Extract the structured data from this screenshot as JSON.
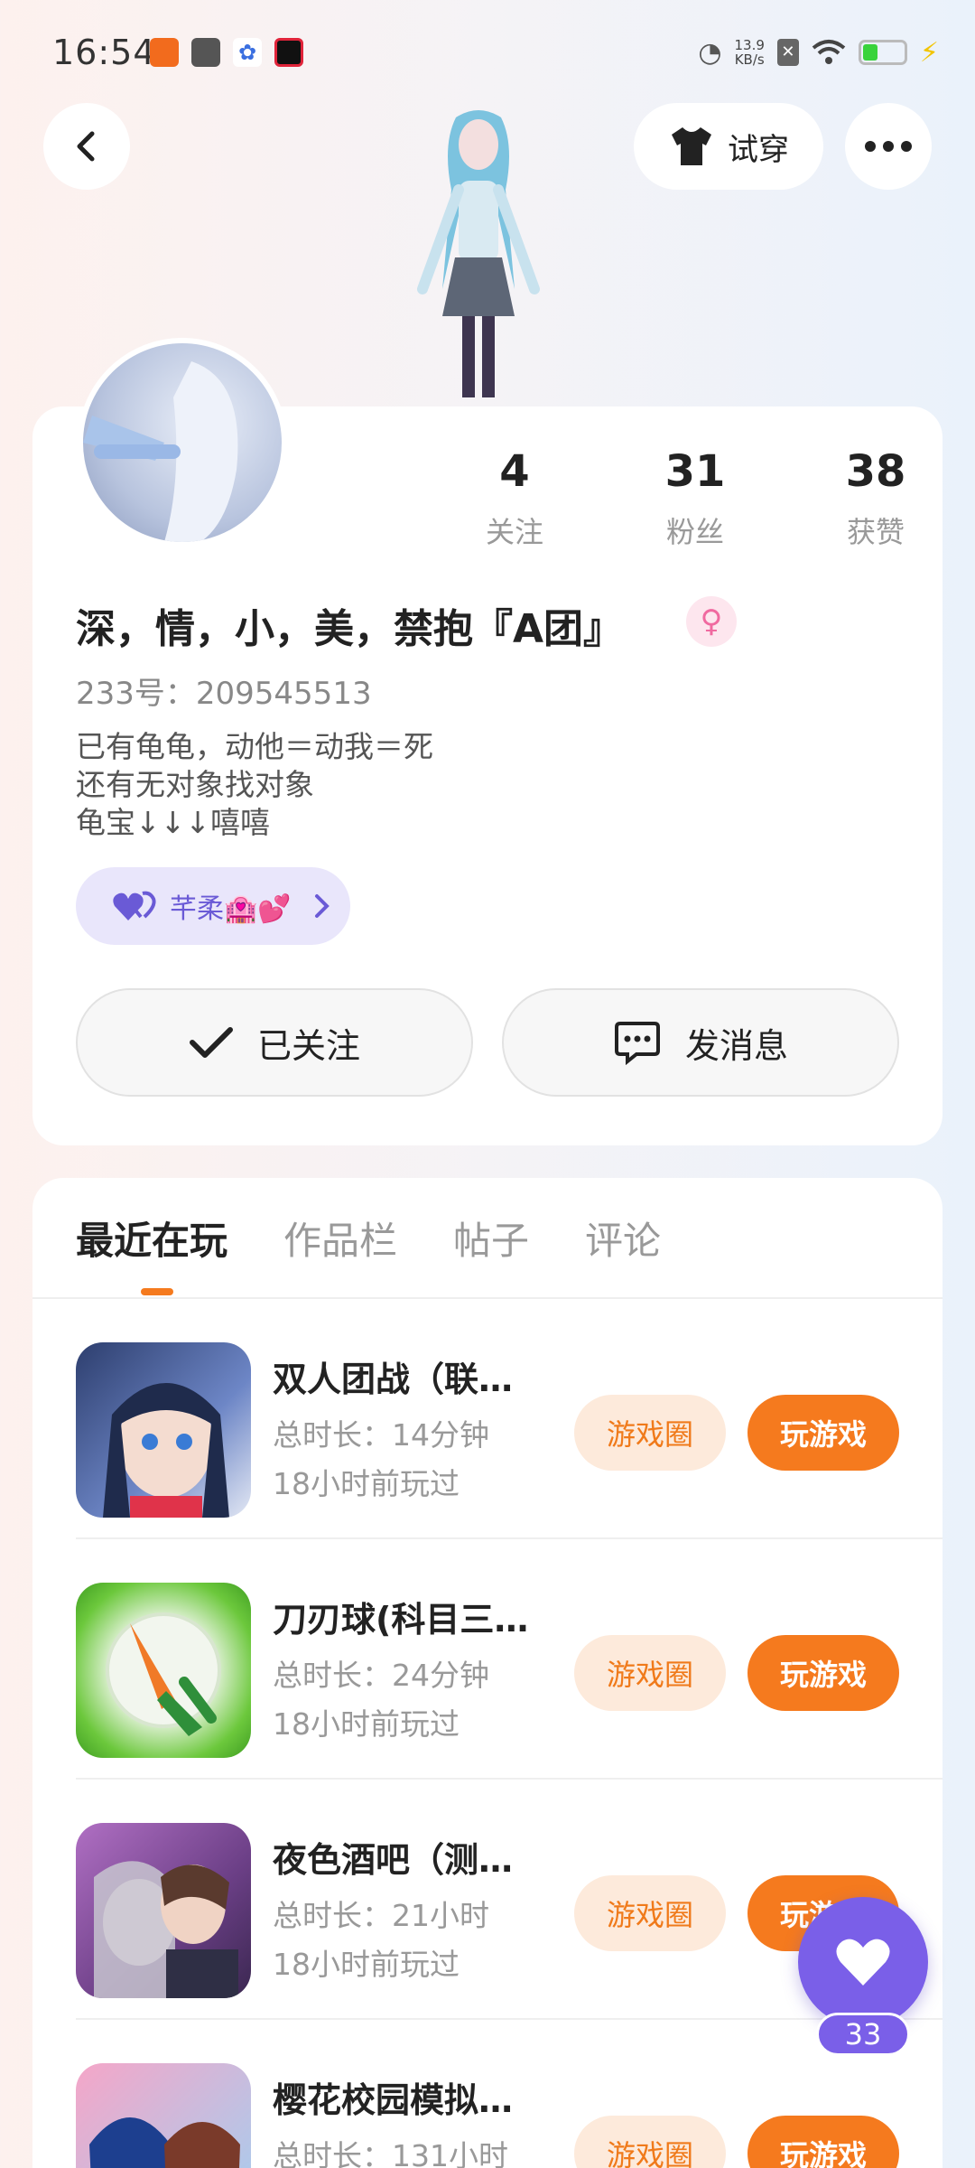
{
  "status_bar": {
    "time": "16:54",
    "net_speed_value": "13.9",
    "net_speed_unit": "KB/s"
  },
  "header": {
    "try_on_label": "试穿"
  },
  "profile": {
    "stats": [
      {
        "value": "4",
        "label": "关注"
      },
      {
        "value": "31",
        "label": "粉丝"
      },
      {
        "value": "38",
        "label": "获赞"
      }
    ],
    "nickname": "深，情，小，美，禁抱『A团』",
    "uid": "233号：209545513",
    "bio": [
      "已有龟龟，动他＝动我＝死",
      "还有无对象找对象",
      "龟宝↓↓↓嘻嘻"
    ],
    "cp_name": "芊柔🏩💕",
    "follow_label": "已关注",
    "message_label": "发消息"
  },
  "tabs": [
    "最近在玩",
    "作品栏",
    "帖子",
    "评论"
  ],
  "games": [
    {
      "title": "双人团战（联…",
      "duration": "总时长：14分钟",
      "last_played": "18小时前玩过"
    },
    {
      "title": "刀刃球(科目三…",
      "duration": "总时长：24分钟",
      "last_played": "18小时前玩过"
    },
    {
      "title": "夜色酒吧（测…",
      "duration": "总时长：21小时",
      "last_played": "18小时前玩过"
    },
    {
      "title": "樱花校园模拟…",
      "duration": "总时长：131小时",
      "last_played": ""
    }
  ],
  "game_buttons": {
    "circle": "游戏圈",
    "play": "玩游戏"
  },
  "like_count": "33",
  "colors": {
    "accent_orange": "#f57a1e",
    "accent_purple": "#7a5fe8",
    "gender_pink": "#f06aa0"
  }
}
